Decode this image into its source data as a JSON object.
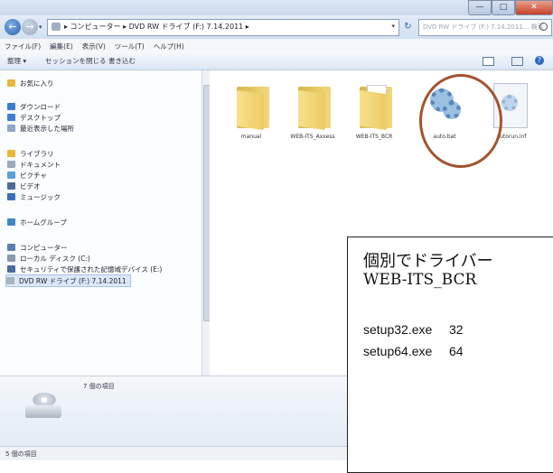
{
  "window": {
    "controls": {
      "minimize": "—",
      "maximize": "□",
      "close": "✕"
    }
  },
  "address_bar": {
    "back_icon": "←",
    "forward_icon": "→",
    "path": "▸ コンピューター ▸ DVD RW ドライブ (F:) 7.14.2011 ▸",
    "search_placeholder": "DVD RW ドライブ (F:) 7.14.2011... 検索",
    "refresh_icon": "↻"
  },
  "menu": [
    "ファイル(F)",
    "編集(E)",
    "表示(V)",
    "ツール(T)",
    "ヘルプ(H)"
  ],
  "toolbar": {
    "organize": "整理 ▾",
    "close_session": "セッションを閉じる",
    "burn": "書き込む"
  },
  "nav_pane": {
    "items": [
      {
        "label": "お気に入り",
        "color": "#e7b93a"
      },
      {
        "label": "ダウンロード",
        "color": "#3f7ccf"
      },
      {
        "label": "デスクトップ",
        "color": "#3f7ccf"
      },
      {
        "label": "最近表示した場所",
        "color": "#8fa6c4"
      },
      {
        "label": "ライブラリ",
        "color": "#e7b93a"
      },
      {
        "label": "ドキュメント",
        "color": "#9aa9bc"
      },
      {
        "label": "ピクチャ",
        "color": "#5aa0d8"
      },
      {
        "label": "ビデオ",
        "color": "#4c6a94"
      },
      {
        "label": "ミュージック",
        "color": "#3a6fb6"
      },
      {
        "label": "ホームグループ",
        "color": "#3f87c9"
      },
      {
        "label": "コンピューター",
        "color": "#5a7fae"
      },
      {
        "label": "ローカル ディスク (C:)",
        "color": "#8a99ad"
      },
      {
        "label": "セキュリティで保護された記憶域デバイス (E:)",
        "color": "#4a6c9c"
      },
      {
        "label": "DVD RW ドライブ (F:) 7.14.2011",
        "color": "#aab4c0"
      }
    ]
  },
  "files": [
    {
      "name": "manual",
      "type": "folder"
    },
    {
      "name": "WEB-ITS_Axxess",
      "type": "folder"
    },
    {
      "name": "WEB-ITS_BCR",
      "type": "folder"
    },
    {
      "name": "auto.bat",
      "type": "bat"
    },
    {
      "name": "autorun.inf",
      "type": "inf"
    }
  ],
  "details": {
    "item_count": "7 個の項目"
  },
  "status": {
    "text": "5 個の項目"
  },
  "annotation": {
    "line1": "個別でドライバー",
    "line2": "WEB-ITS_BCR",
    "rows": [
      {
        "file": "setup32.exe",
        "arch": "32"
      },
      {
        "file": "setup64.exe",
        "arch": "64"
      }
    ]
  }
}
